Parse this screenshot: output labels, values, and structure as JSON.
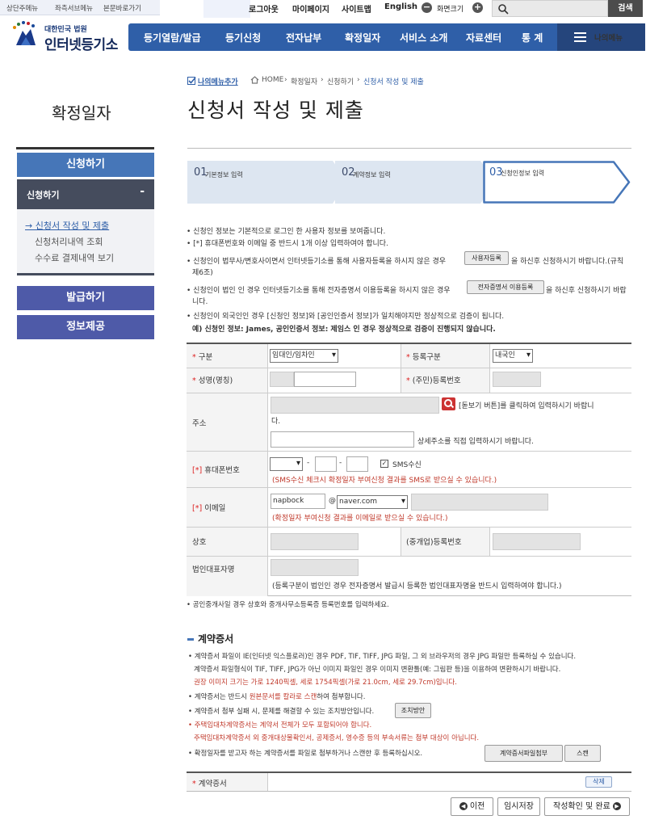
{
  "utility": {
    "skip_links": [
      "상단주메뉴",
      "좌측서브메뉴",
      "본문바로가기"
    ],
    "links": [
      "로그아웃",
      "마이페이지",
      "사이트맵",
      "English"
    ],
    "zoom_label": "화면크기",
    "zoom_minus": "−",
    "zoom_plus": "+",
    "search_button": "검색"
  },
  "logo": {
    "sub": "대한민국 법원",
    "main": "인터넷등기소"
  },
  "gnb": [
    "등기열람/발급",
    "등기신청",
    "전자납부",
    "확정일자",
    "서비스 소개",
    "자료센터",
    "통 계"
  ],
  "my_menu": "나의메뉴",
  "lnb": {
    "title": "확정일자",
    "main_button": "신청하기",
    "sub_header": "신청하기",
    "sub_toggle": "-",
    "items": [
      "→ 신청서 작성 및 제출",
      "신청처리내역 조회",
      "수수료 결제내역 보기"
    ],
    "buttons": [
      "발급하기",
      "정보제공"
    ]
  },
  "breadcrumb": {
    "my_menu_add": "나의메뉴추가",
    "path": [
      "HOME",
      "확정일자",
      "신청하기",
      "신청서 작성 및 제출"
    ]
  },
  "page_title": "신청서 작성 및 제출",
  "steps": [
    {
      "num": "01",
      "name": "기본정보 입력"
    },
    {
      "num": "02",
      "name": "계약정보 입력"
    },
    {
      "num": "03",
      "name": "신청인정보 입력"
    }
  ],
  "notices": {
    "n1": "신청인 정보는 기본적으로 로그인 한 사용자 정보를 보여줍니다.",
    "n2": "[*] 휴대폰번호와 이메일 중 반드시 1개 이상 입력하여야 합니다.",
    "n3a": "신청인이 법무사/변호사이면서 인터넷등기소를 통해 사용자등록을 하시지 않은 경우",
    "n3_btn": "사용자등록",
    "n3b": "을 하신후 신청하시기 바랍니다.(규칙",
    "n3c": "제6조)",
    "n4a": "신청인이 법인 인 경우 인터넷등기소를 통해 전자증명서 이용등록을 하시지 않은 경우",
    "n4_btn": "전자증명서 이용등록",
    "n4b": "을 하신후 신청하시기 바랍",
    "n4c": "니다.",
    "n5": "신청인이 외국인인 경우 [신청인 정보]와 [공인인증서 정보]가 일치해야지만 정상적으로 검증이 됩니다.",
    "n6": "예) 신청인 정보: James, 공인인증서 정보: 제임스 인 경우 정상적으로 검증이 진행되지 않습니다."
  },
  "form": {
    "gubun_label": "구분",
    "gubun_value": "임대인/임차인",
    "reg_type_label": "등록구분",
    "reg_type_value": "내국인",
    "name_label": "성명(명칭)",
    "id_label": "(주민)등록번호",
    "address_label": "주소",
    "address_hint": "[돋보기 버튼]를 클릭하여 입력하시기 바랍니",
    "address_hint2": "다.",
    "address_detail_hint": "상세주소를 직접 입력하시기 바랍니다.",
    "phone_label": "휴대폰번호",
    "phone_prefix": "[*]",
    "phone_dash": "-",
    "sms_label": "SMS수신",
    "sms_checked": "✓",
    "sms_hint": "(SMS수신 체크시 확정일자 부여신청 결과를 SMS로 받으실 수 있습니다.)",
    "email_label": "이메일",
    "email_prefix": "[*]",
    "email_id": "napbock",
    "email_at": "@",
    "email_domain": "naver.com",
    "email_hint": "(확정일자 부여신청 결과를 이메일로 받으실 수 있습니다.)",
    "company_label": "상호",
    "broker_label": "(중개업)등록번호",
    "rep_label": "법인대표자명",
    "rep_hint": "(등록구분이 법인인 경우 전자증명서 발급시 등록한 법인대표자명을 반드시 입력하여야 합니다.)",
    "required_mark": "*"
  },
  "form_note": "공인중개사일 경우 상호와 중개사무소등록증 등록번호를 입력하세요.",
  "contract": {
    "title": "계약증서",
    "l1": "계약증서 파일이 IE(인터넷 익스플로러)인 경우 PDF, TIF, TIFF, JPG 파일, 그 외 브라우저의 경우 JPG 파일만 등록하실 수 있습니다.",
    "l2": "계약증서 파일형식이 TIF, TIFF, JPG가 아닌 이미지 파일인 경우 이미지 변환툴(예: 그림판 등)을 이용하여 변환하시기 바랍니다.",
    "l3": "권장 이미지 크기는 가로 1240픽셀, 세로 1754픽셀(가로 21.0cm, 세로 29.7cm)입니다.",
    "l4a": "계약증서는 반드시",
    "l4r": "원본문서를 칼라로 스캔",
    "l4b": "하여 첨부합니다.",
    "l5": "계약증서 첨부 실패 시, 문제를 해결할 수 있는 조치방안입니다.",
    "l5_btn": "조치방안",
    "l6": "주택임대차계약증서는 계약서 전체가 모두 포함되어야 합니다.",
    "l7": "주택임대차계약증서 외 중개대상물확인서, 공제증서, 영수증 등의 부속서류는 첨부 대상이 아닙니다.",
    "l8": "확정일자를 받고자 하는 계약증서를 파일로 첨부하거나 스캔한 후 등록하십시오.",
    "attach_btn": "계약증서파일첨부",
    "scan_btn": "스캔",
    "row_label": "계약증서",
    "delete_btn": "삭제"
  },
  "bottom_buttons": {
    "prev": "이전",
    "save": "임시저장",
    "confirm": "작성확인 및 완료"
  },
  "colors": {
    "gnb": "#2f5fa8",
    "lnb_blue": "#4676b8",
    "lnb_purple": "#4e5aa8",
    "required": "#d22222"
  }
}
